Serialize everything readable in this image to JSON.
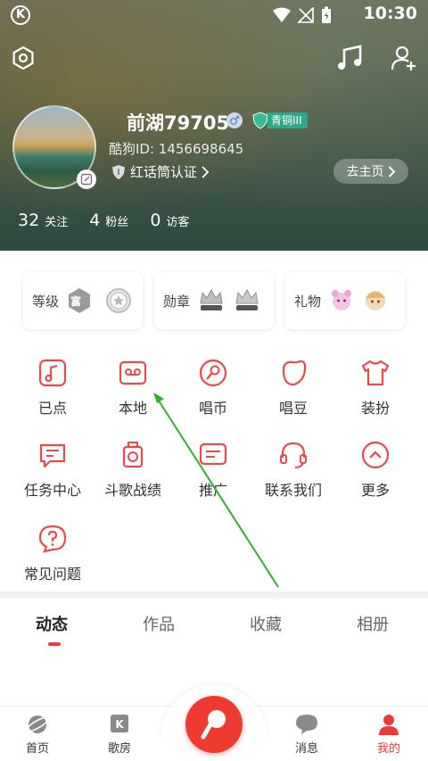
{
  "status_bar": {
    "time": "10:30",
    "app_glyph": "K"
  },
  "profile": {
    "username": "前湖79705",
    "level": "青铜III",
    "kugou_id": "酷狗ID: 1456698645",
    "verify": "红话筒认证",
    "home_button": "去主页"
  },
  "stats": [
    {
      "num": "32",
      "label": "关注"
    },
    {
      "num": "4",
      "label": "粉丝"
    },
    {
      "num": "0",
      "label": "访客"
    }
  ],
  "cards": [
    {
      "label": "等级",
      "badge": "富"
    },
    {
      "label": "勋章"
    },
    {
      "label": "礼物"
    }
  ],
  "menu": [
    {
      "label": "已点",
      "icon": "music-note-icon"
    },
    {
      "label": "本地",
      "icon": "cassette-icon"
    },
    {
      "label": "唱币",
      "icon": "mic-coin-icon"
    },
    {
      "label": "唱豆",
      "icon": "bean-icon"
    },
    {
      "label": "装扮",
      "icon": "tshirt-icon"
    },
    {
      "label": "任务中心",
      "icon": "task-icon"
    },
    {
      "label": "斗歌战绩",
      "icon": "trophy-icon"
    },
    {
      "label": "推广",
      "icon": "promo-icon"
    },
    {
      "label": "联系我们",
      "icon": "headset-icon"
    },
    {
      "label": "更多",
      "icon": "chevron-up-icon"
    },
    {
      "label": "常见问题",
      "icon": "question-icon"
    }
  ],
  "tabs": [
    "动态",
    "作品",
    "收藏",
    "相册"
  ],
  "bottom_nav": [
    {
      "label": "首页",
      "icon": "planet-icon"
    },
    {
      "label": "歌房",
      "icon": "k-room-icon"
    },
    {
      "label": "消息",
      "icon": "message-icon"
    },
    {
      "label": "我的",
      "icon": "user-icon"
    }
  ],
  "colors": {
    "accent": "#ee3a3a",
    "level_badge": "#2fa88a",
    "annotation": "#2fb02f"
  }
}
